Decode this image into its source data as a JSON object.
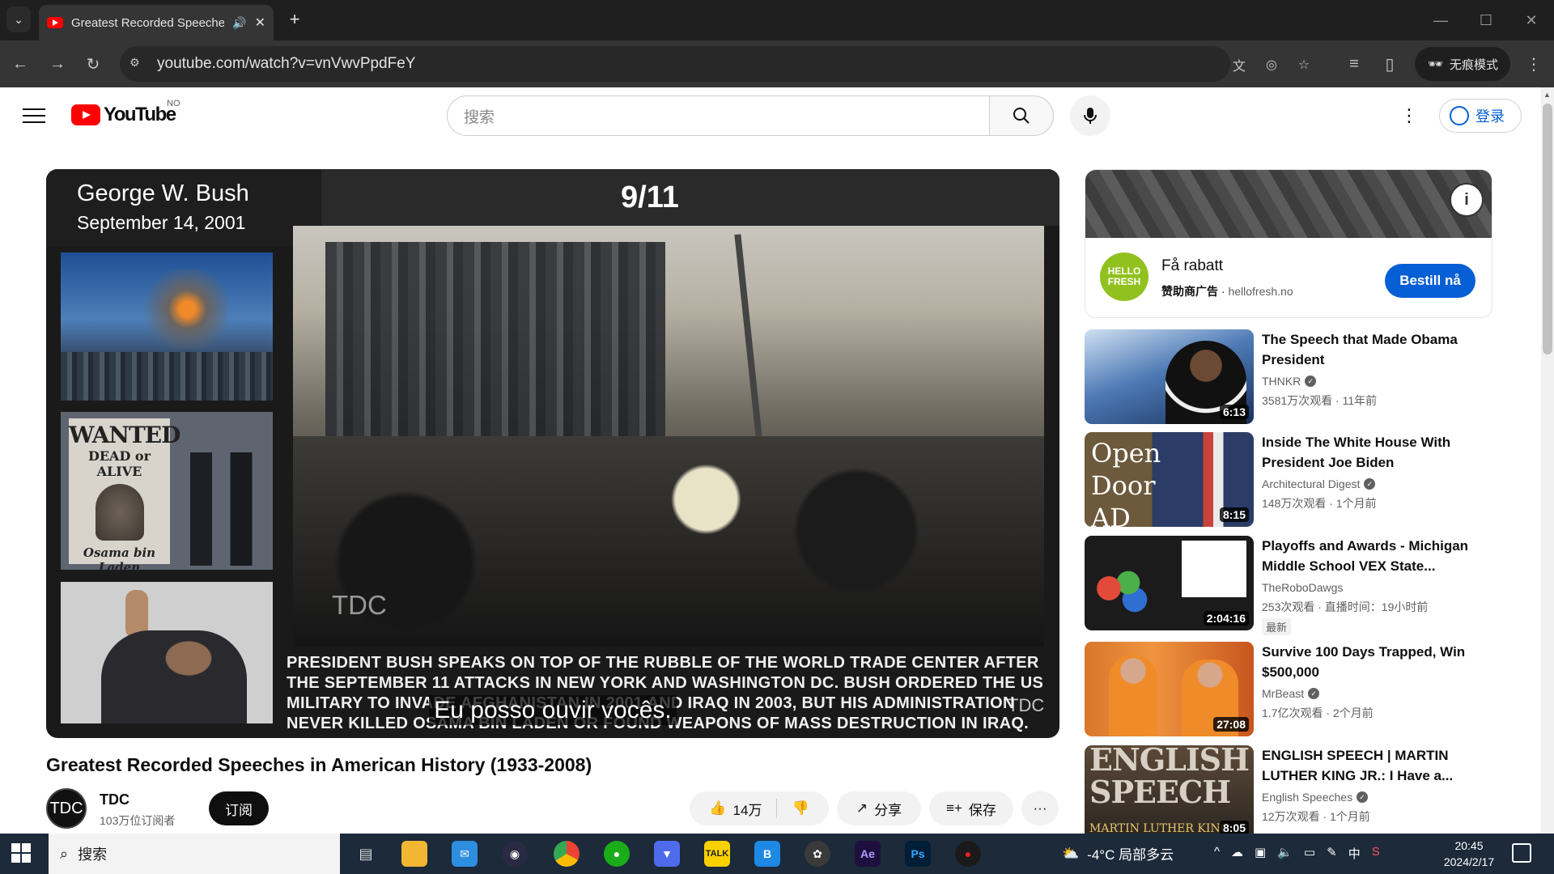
{
  "browser": {
    "tab_title": "Greatest Recorded Speeches in American History",
    "url": "youtube.com/watch?v=vnVwvPpdFeY",
    "incognito_label": "无痕模式",
    "new_tab": "+",
    "audio_icon": "speaker-icon",
    "close_glyph": "✕"
  },
  "youtube": {
    "logo_text": "YouTube",
    "region": "NO",
    "search_placeholder": "搜索",
    "signin_label": "登录"
  },
  "player": {
    "overlay_name": "George W. Bush",
    "overlay_date": "September 14, 2001",
    "overlay_heading": "9/11",
    "watermark": "TDC",
    "description": "PRESIDENT BUSH SPEAKS ON TOP OF THE RUBBLE OF THE WORLD TRADE CENTER AFTER THE SEPTEMBER 11 ATTACKS IN NEW YORK AND WASHINGTON DC. BUSH ORDERED THE US MILITARY TO INVADE AFGHANISTAN IN 2001 AND IRAQ IN 2003, BUT HIS ADMINISTRATION NEVER KILLED OSAMA BIN LADEN OR FOUND WEAPONS OF MASS DESTRUCTION IN IRAQ.",
    "subtitle": "Eu posso ouvir vocês.",
    "poster_wanted": "WANTED",
    "poster_dead": "DEAD or ALIVE",
    "poster_name": "Osama bin Laden"
  },
  "video": {
    "title": "Greatest Recorded Speeches in American History (1933-2008)",
    "channel": "TDC",
    "subscribers": "103万位订阅者",
    "subscribe_label": "订阅",
    "likes": "14万",
    "share_label": "分享",
    "save_label": "保存"
  },
  "ad": {
    "logo": "HELLO FRESH",
    "headline": "Få rabatt",
    "sponsor_label": "赞助商广告",
    "domain": "hellofresh.no",
    "cta": "Bestill nå"
  },
  "recommendations": [
    {
      "title": "The Speech that Made Obama President",
      "channel": "THNKR",
      "verified": true,
      "meta": "3581万次观看 · 11年前",
      "duration": "6:13"
    },
    {
      "title": "Inside The White House With President Joe Biden",
      "channel": "Architectural Digest",
      "verified": true,
      "meta": "148万次观看 · 1个月前",
      "duration": "8:15",
      "thumb_text": "Open Door AD"
    },
    {
      "title": "Playoffs and Awards - Michigan Middle School VEX State...",
      "channel": "TheRoboDawgs",
      "verified": false,
      "meta": "253次观看 · 直播时间：19小时前",
      "duration": "2:04:16",
      "badge": "最新"
    },
    {
      "title": "Survive 100 Days Trapped, Win $500,000",
      "channel": "MrBeast",
      "verified": true,
      "meta": "1.7亿次观看 · 2个月前",
      "duration": "27:08"
    },
    {
      "title": "ENGLISH SPEECH | MARTIN LUTHER KING JR.: I Have a...",
      "channel": "English Speeches",
      "verified": true,
      "meta": "12万次观看 · 1个月前",
      "duration": "8:05",
      "thumb_text": "ENGLISH SPEECH",
      "thumb_sub": "MARTIN LUTHER KING"
    }
  ],
  "taskbar": {
    "search_label": "搜索",
    "weather": "-4°C 局部多云",
    "ime": "中",
    "time": "20:45",
    "date": "2024/2/17"
  },
  "colors": {
    "yt_red": "#ff0000",
    "link_blue": "#065fd4",
    "hellofresh_green": "#91c11e",
    "taskbar": "#1c2a3a"
  }
}
